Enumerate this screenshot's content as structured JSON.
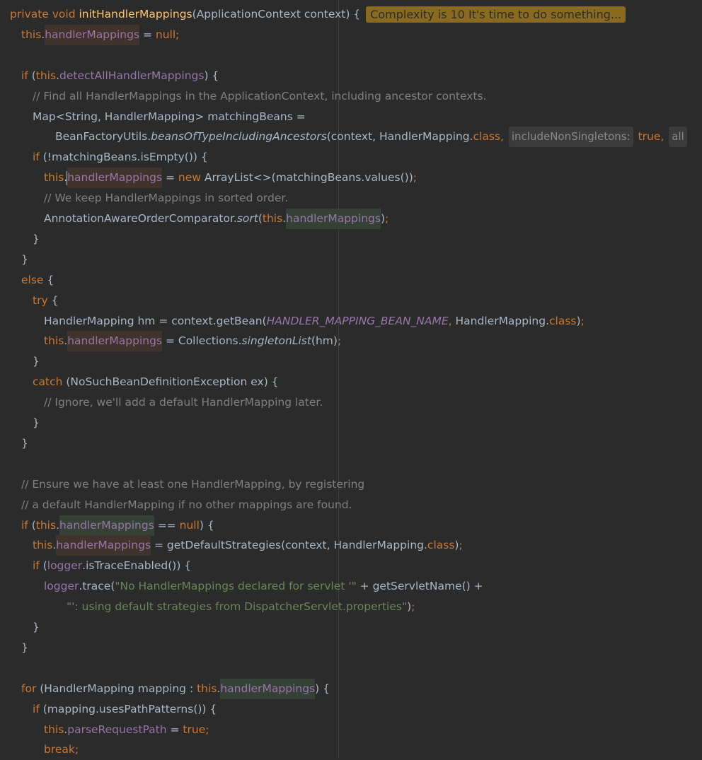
{
  "editor": {
    "badge": "Complexity is 10 It's time to do something...",
    "lines": [
      [
        [
          "kw",
          "private void "
        ],
        [
          "fn",
          "initHandlerMappings"
        ],
        [
          "p",
          "(ApplicationContext context) {"
        ]
      ],
      [
        [
          "kw",
          "this"
        ],
        [
          "p",
          "."
        ],
        [
          "field hl-write",
          "handlerMappings"
        ],
        [
          "p",
          " = "
        ],
        [
          "kw",
          "null"
        ],
        [
          "kw",
          ";"
        ]
      ],
      [],
      [
        [
          "kw",
          "if "
        ],
        [
          "p",
          "("
        ],
        [
          "kw",
          "this"
        ],
        [
          "p",
          "."
        ],
        [
          "field",
          "detectAllHandlerMappings"
        ],
        [
          "p",
          ") {"
        ]
      ],
      [
        [
          "cmt",
          "// Find all HandlerMappings in the ApplicationContext, including ancestor contexts."
        ]
      ],
      [
        [
          "p",
          "Map<String, HandlerMapping> matchingBeans ="
        ]
      ],
      [
        [
          "p",
          "BeanFactoryUtils."
        ],
        [
          "static-call",
          "beansOfTypeIncludingAncestors"
        ],
        [
          "p",
          "(context, HandlerMapping."
        ],
        [
          "kw",
          "class"
        ],
        [
          "kw",
          ", "
        ],
        [
          "hint",
          "includeNonSingletons:"
        ],
        [
          "kw",
          " true"
        ],
        [
          "kw",
          ", "
        ],
        [
          "hint",
          "all"
        ]
      ],
      [
        [
          "kw",
          "if "
        ],
        [
          "p",
          "(!matchingBeans.isEmpty()) {"
        ]
      ],
      [
        [
          "kw",
          "this"
        ],
        [
          "p",
          "."
        ],
        [
          "caret",
          ""
        ],
        [
          "field hl-write",
          "handlerMappings"
        ],
        [
          "p",
          " = "
        ],
        [
          "kw",
          "new "
        ],
        [
          "p",
          "ArrayList<>(matchingBeans.values())"
        ],
        [
          "kw",
          ";"
        ]
      ],
      [
        [
          "cmt",
          "// We keep HandlerMappings in sorted order."
        ]
      ],
      [
        [
          "p",
          "AnnotationAwareOrderComparator."
        ],
        [
          "static-call",
          "sort"
        ],
        [
          "p",
          "("
        ],
        [
          "kw",
          "this"
        ],
        [
          "p",
          "."
        ],
        [
          "field hl-read",
          "handlerMappings"
        ],
        [
          "p",
          ")"
        ],
        [
          "kw",
          ";"
        ]
      ],
      [
        [
          "p",
          "}"
        ]
      ],
      [
        [
          "p",
          "}"
        ]
      ],
      [
        [
          "kw",
          "else "
        ],
        [
          "p",
          "{"
        ]
      ],
      [
        [
          "kw",
          "try "
        ],
        [
          "p",
          "{"
        ]
      ],
      [
        [
          "p",
          "HandlerMapping hm = context.getBean("
        ],
        [
          "static-fld",
          "HANDLER_MAPPING_BEAN_NAME"
        ],
        [
          "kw",
          ", "
        ],
        [
          "p",
          "HandlerMapping."
        ],
        [
          "kw",
          "class"
        ],
        [
          "p",
          ")"
        ],
        [
          "kw",
          ";"
        ]
      ],
      [
        [
          "kw",
          "this"
        ],
        [
          "p",
          "."
        ],
        [
          "field hl-write",
          "handlerMappings"
        ],
        [
          "p",
          " = Collections."
        ],
        [
          "static-call",
          "singletonList"
        ],
        [
          "p",
          "(hm)"
        ],
        [
          "kw",
          ";"
        ]
      ],
      [
        [
          "p",
          "}"
        ]
      ],
      [
        [
          "kw",
          "catch "
        ],
        [
          "p",
          "(NoSuchBeanDefinitionException ex) {"
        ]
      ],
      [
        [
          "cmt",
          "// Ignore, we'll add a default HandlerMapping later."
        ]
      ],
      [
        [
          "p",
          "}"
        ]
      ],
      [
        [
          "p",
          "}"
        ]
      ],
      [],
      [
        [
          "cmt",
          "// Ensure we have at least one HandlerMapping, by registering"
        ]
      ],
      [
        [
          "cmt",
          "// a default HandlerMapping if no other mappings are found."
        ]
      ],
      [
        [
          "kw",
          "if "
        ],
        [
          "p",
          "("
        ],
        [
          "kw",
          "this"
        ],
        [
          "p",
          "."
        ],
        [
          "field hl-read",
          "handlerMappings"
        ],
        [
          "p",
          " == "
        ],
        [
          "kw",
          "null"
        ],
        [
          "p",
          ") {"
        ]
      ],
      [
        [
          "kw",
          "this"
        ],
        [
          "p",
          "."
        ],
        [
          "field hl-write",
          "handlerMappings"
        ],
        [
          "p",
          " = getDefaultStrategies(context, HandlerMapping."
        ],
        [
          "kw",
          "class"
        ],
        [
          "p",
          ")"
        ],
        [
          "kw",
          ";"
        ]
      ],
      [
        [
          "kw",
          "if "
        ],
        [
          "p",
          "("
        ],
        [
          "field",
          "logger"
        ],
        [
          "p",
          ".isTraceEnabled()) {"
        ]
      ],
      [
        [
          "field",
          "logger"
        ],
        [
          "p",
          ".trace("
        ],
        [
          "str",
          "\"No HandlerMappings declared for servlet '\""
        ],
        [
          "p",
          " + getServletName() +"
        ]
      ],
      [
        [
          "str",
          "\"': using default strategies from DispatcherServlet.properties\""
        ],
        [
          "p",
          ")"
        ],
        [
          "kw",
          ";"
        ]
      ],
      [
        [
          "p",
          "}"
        ]
      ],
      [
        [
          "p",
          "}"
        ]
      ],
      [],
      [
        [
          "kw",
          "for "
        ],
        [
          "p",
          "(HandlerMapping mapping : "
        ],
        [
          "kw",
          "this"
        ],
        [
          "p",
          "."
        ],
        [
          "field hl-read",
          "handlerMappings"
        ],
        [
          "p",
          ") {"
        ]
      ],
      [
        [
          "kw",
          "if "
        ],
        [
          "p",
          "(mapping.usesPathPatterns()) {"
        ]
      ],
      [
        [
          "kw",
          "this"
        ],
        [
          "p",
          "."
        ],
        [
          "field",
          "parseRequestPath"
        ],
        [
          "p",
          " = "
        ],
        [
          "kw",
          "true"
        ],
        [
          "kw",
          ";"
        ]
      ],
      [
        [
          "kw",
          "break"
        ],
        [
          "kw",
          ";"
        ]
      ]
    ]
  }
}
